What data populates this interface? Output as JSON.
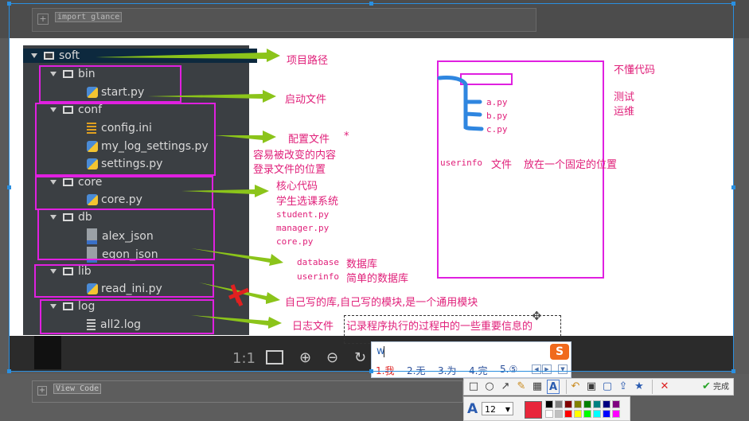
{
  "background": {
    "code_box_top": "import glance",
    "code_box_bottom": "View Code"
  },
  "tree": {
    "items": [
      {
        "label": "soft",
        "kind": "folder"
      },
      {
        "label": "bin",
        "kind": "folder"
      },
      {
        "label": "start.py",
        "kind": "py"
      },
      {
        "label": "conf",
        "kind": "folder"
      },
      {
        "label": "config.ini",
        "kind": "ini"
      },
      {
        "label": "my_log_settings.py",
        "kind": "py"
      },
      {
        "label": "settings.py",
        "kind": "py"
      },
      {
        "label": "core",
        "kind": "folder"
      },
      {
        "label": "core.py",
        "kind": "py"
      },
      {
        "label": "db",
        "kind": "folder"
      },
      {
        "label": "alex_json",
        "kind": "json"
      },
      {
        "label": "egon_json",
        "kind": "json"
      },
      {
        "label": "lib",
        "kind": "folder"
      },
      {
        "label": "read_ini.py",
        "kind": "py"
      },
      {
        "label": "log",
        "kind": "folder"
      },
      {
        "label": "all2.log",
        "kind": "log"
      }
    ]
  },
  "annotations": {
    "project_path": "项目路径",
    "startup_file": "启动文件",
    "config_file": "配置文件",
    "star": "*",
    "easy_change": "容易被改变的内容",
    "login_location": "登录文件的位置",
    "core_code": "核心代码",
    "course_system": "学生选课系统",
    "student_py": "student.py",
    "manager_py": "manager.py",
    "core_py": "core.py",
    "database_en": "database",
    "database_cn": "数据库",
    "userinfo_en": "userinfo",
    "simple_db": "简单的数据库",
    "own_lib": "自己写的库,自己写的模块,是一个通用模块",
    "log_file": "日志文件",
    "log_desc": "记录程序执行的过程中的一些重要信息的",
    "not_code": "不懂代码",
    "test": "测试",
    "ops": "运维",
    "file_a": "a.py",
    "file_b": "b.py",
    "file_c": "c.py",
    "userinfo_file": "userinfo",
    "wenjian": "文件",
    "fixed_pos": "放在一个固定的位置"
  },
  "viewer": {
    "ratio": "1:1"
  },
  "ime": {
    "composition": "w",
    "logo": "S",
    "candidates": [
      "1.我",
      "2.无",
      "3.为",
      "4.完",
      "5.⑤"
    ]
  },
  "toolbar": {
    "done_label": "完成",
    "font_size": "12",
    "font_icon": "A",
    "current_color": "#e8263a",
    "palette": [
      "#000000",
      "#808080",
      "#800000",
      "#808000",
      "#008000",
      "#008080",
      "#000080",
      "#800080",
      "#ffffff",
      "#c0c0c0",
      "#ff0000",
      "#ffff00",
      "#00ff00",
      "#00ffff",
      "#0000ff",
      "#ff00ff"
    ]
  }
}
